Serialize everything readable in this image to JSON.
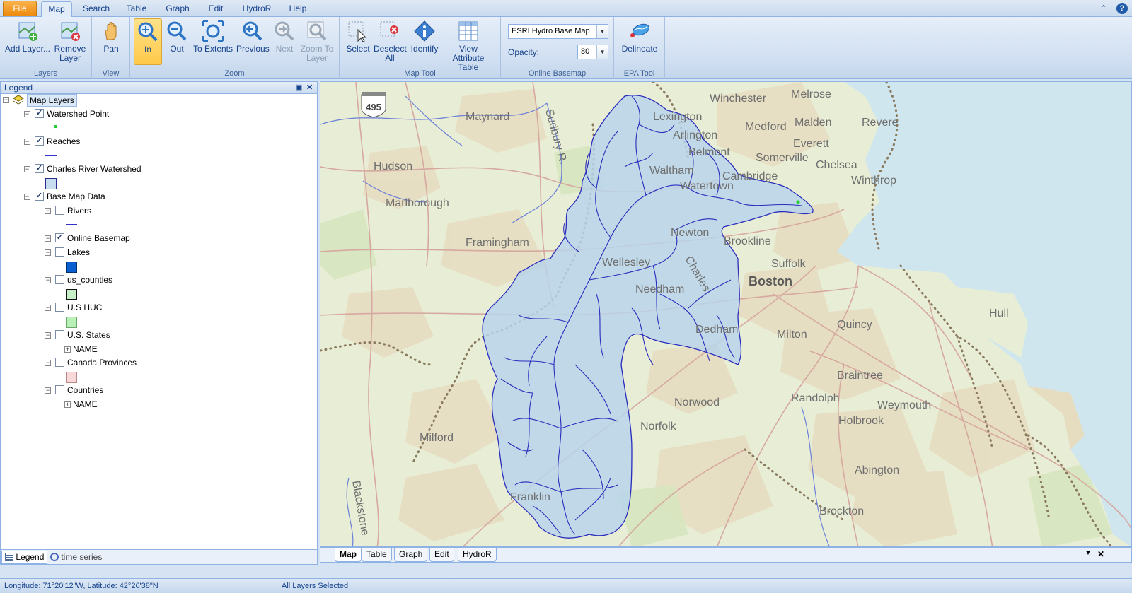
{
  "menu_tabs": [
    "File",
    "Map",
    "Search",
    "Table",
    "Graph",
    "Edit",
    "HydroR",
    "Help"
  ],
  "window_controls": {
    "collapse_icon": "chevron-up-icon",
    "help_icon": "help-icon",
    "help_glyph": "?"
  },
  "ribbon": {
    "groups": {
      "layers": "Layers",
      "view": "View",
      "zoom": "Zoom",
      "map_tool": "Map Tool",
      "online_basemap": "Online Basemap",
      "epa_tool": "EPA Tool"
    },
    "buttons": {
      "add_layer": "Add Layer...",
      "remove_layer_1": "Remove",
      "remove_layer_2": "Layer",
      "pan": "Pan",
      "zoom_in": "In",
      "zoom_out": "Out",
      "to_extents": "To Extents",
      "previous": "Previous",
      "next": "Next",
      "zoom_to_layer_1": "Zoom To",
      "zoom_to_layer_2": "Layer",
      "select": "Select",
      "deselect_all_1": "Deselect",
      "deselect_all_2": "All",
      "identify": "Identify",
      "view_attr_1": "View Attribute",
      "view_attr_2": "Table",
      "delineate": "Delineate"
    },
    "basemap": {
      "selected": "ESRI Hydro Base Map",
      "opacity_label": "Opacity:",
      "opacity_value": "80"
    }
  },
  "legend": {
    "title": "Legend",
    "root": "Map Layers",
    "layers": {
      "watershed_point": "Watershed Point",
      "reaches": "Reaches",
      "charles": "Charles River Watershed",
      "base_map_data": "Base Map Data",
      "rivers": "Rivers",
      "online_basemap": "Online Basemap",
      "lakes": "Lakes",
      "us_counties": "us_counties",
      "us_huc": "U.S HUC",
      "us_states": "U.S. States",
      "us_states_field": "NAME",
      "canada": "Canada Provinces",
      "countries": "Countries",
      "countries_field": "NAME"
    },
    "colors": {
      "watershed_point": "#22cc33",
      "reaches": "#3333cc",
      "charles": "#c8dcef",
      "rivers": "#3333cc",
      "lakes": "#0a5fd0",
      "us_counties": "#c8f0c8",
      "us_huc": "#b8f0b8",
      "canada": "#f8d8d8"
    },
    "bottom_tabs": [
      "Legend",
      "time series"
    ]
  },
  "map": {
    "highway_shield": "495",
    "places": {
      "winchester": "Winchester",
      "melrose": "Melrose",
      "maynard": "Maynard",
      "lexington": "Lexington",
      "medford": "Medford",
      "malden": "Malden",
      "revere": "Revere",
      "arlington": "Arlington",
      "everett": "Everett",
      "belmont": "Belmont",
      "somerville": "Somerville",
      "chelsea": "Chelsea",
      "hudson": "Hudson",
      "waltham": "Waltham",
      "cambridge": "Cambridge",
      "winthrop": "Winthrop",
      "watertown": "Watertown",
      "marlborough": "Marlborough",
      "newton": "Newton",
      "brookline": "Brookline",
      "framingham": "Framingham",
      "wellesley": "Wellesley",
      "suffolk": "Suffolk",
      "boston": "Boston",
      "needham": "Needham",
      "hull": "Hull",
      "quincy": "Quincy",
      "dedham": "Dedham",
      "milton": "Milton",
      "braintree": "Braintree",
      "randolph": "Randolph",
      "norwood": "Norwood",
      "weymouth": "Weymouth",
      "holbrook": "Holbrook",
      "norfolk": "Norfolk",
      "milford": "Milford",
      "abington": "Abington",
      "franklin": "Franklin",
      "brockton": "Brockton",
      "sudbury_river": "Sudbury R.",
      "blackstone": "Blackstone",
      "charles_river": "Charles"
    },
    "colors": {
      "watershed_fill": "#b8d4ea",
      "watershed_stroke": "#2b2bbd",
      "water": "#cfe6ee"
    },
    "tabs": [
      "Map",
      "Table",
      "Graph",
      "Edit",
      "HydroR"
    ]
  },
  "status": {
    "coords": "Longitude: 71°20'12\"W, Latitude: 42°26'38\"N",
    "selection": "All Layers Selected"
  }
}
